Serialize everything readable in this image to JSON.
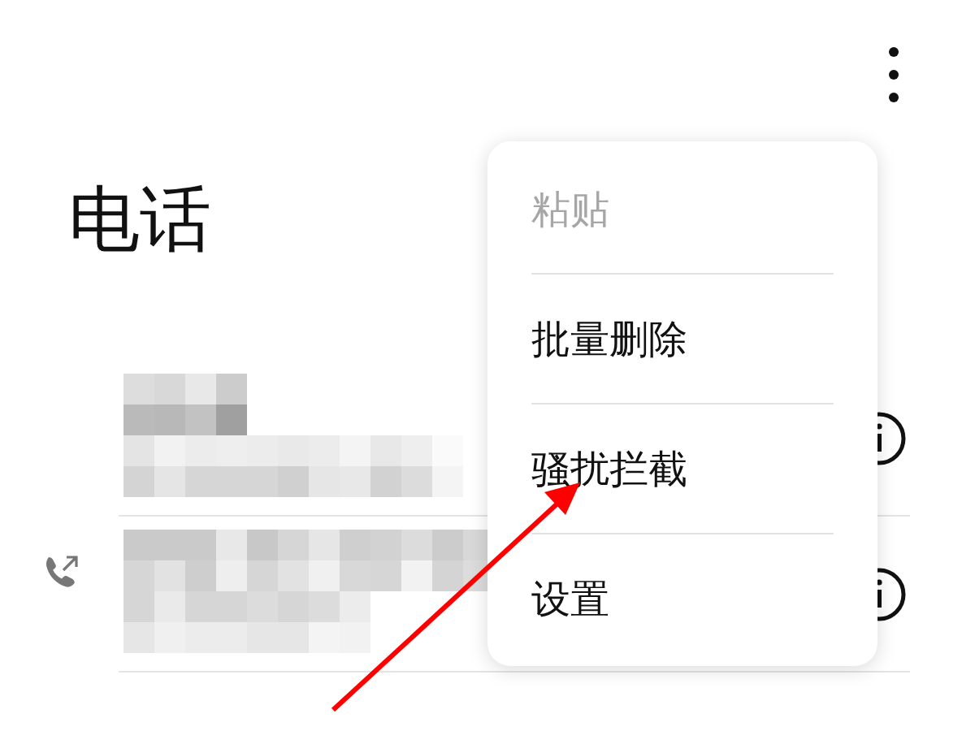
{
  "header": {
    "title": "电话"
  },
  "call_log": [
    {
      "outgoing": false
    },
    {
      "outgoing": true
    }
  ],
  "menu": {
    "items": [
      {
        "label": "粘贴",
        "disabled": true
      },
      {
        "label": "批量删除",
        "disabled": false
      },
      {
        "label": "骚扰拦截",
        "disabled": false
      },
      {
        "label": "设置",
        "disabled": false
      }
    ]
  }
}
